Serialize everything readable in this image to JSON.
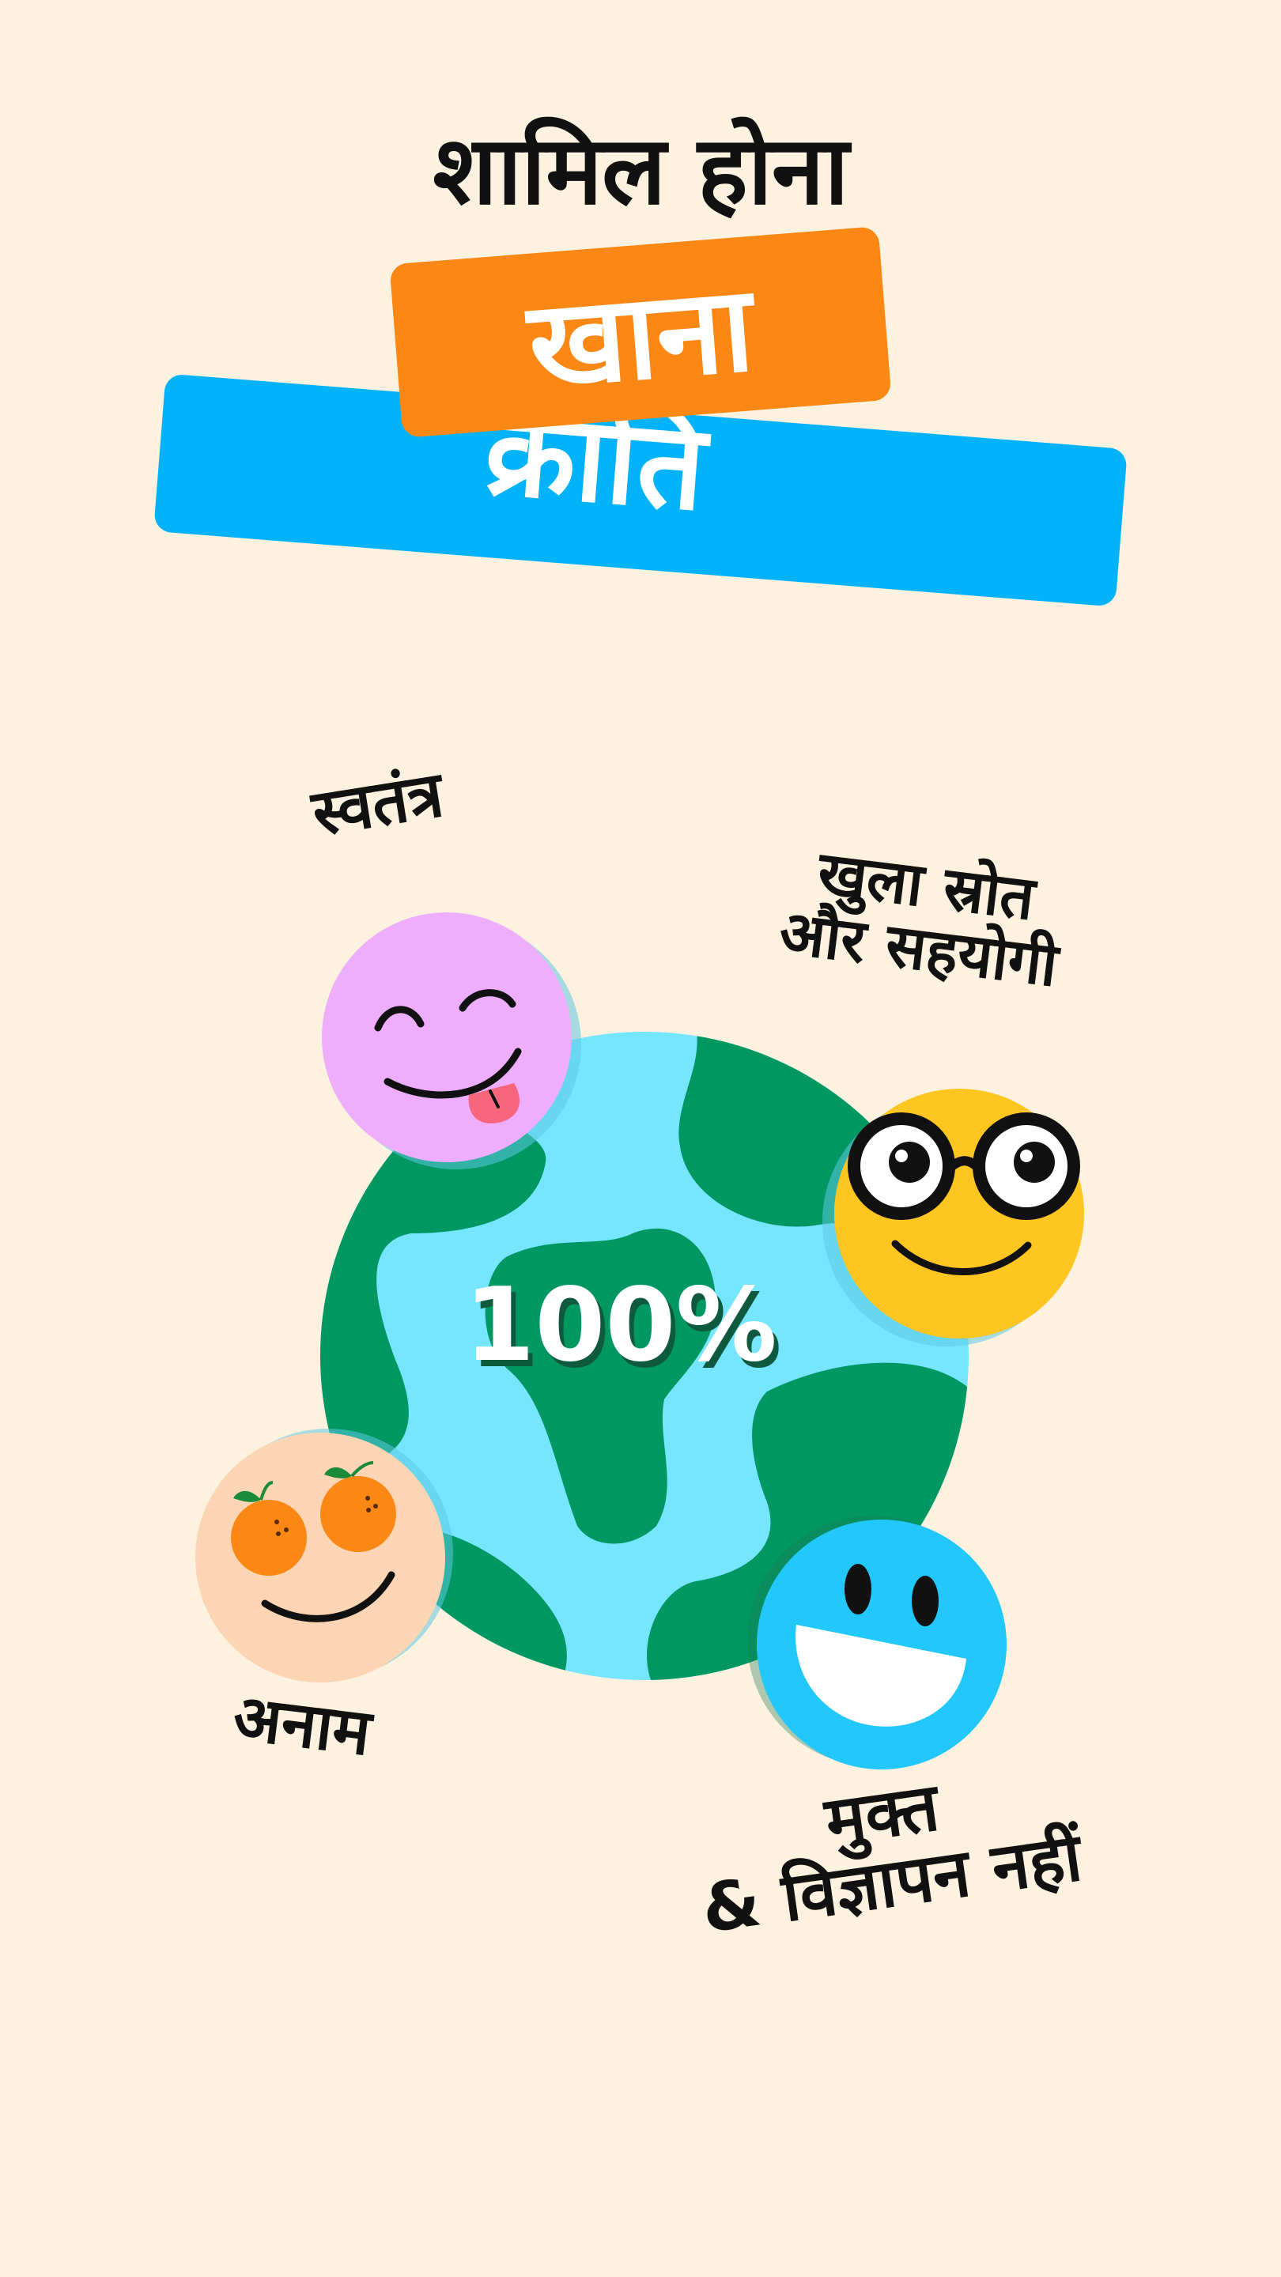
{
  "headline": "शामिल होना",
  "banners": {
    "orange": "खाना",
    "blue": "क्रांति"
  },
  "center_value": "100%",
  "features": {
    "free": "स्वतंत्र",
    "open_source_line1": "खुला स्रोत",
    "open_source_line2": "और सहयोगी",
    "anonymous": "अनाम",
    "ad_free_line1": "मुक्त",
    "ad_free_line2": "& विज्ञापन नहीं"
  },
  "colors": {
    "background": "#fdf1df",
    "orange": "#fb8714",
    "blue": "#02b3f9",
    "globe_ocean": "#76e6fe",
    "globe_land": "#019763",
    "pink_face": "#eeaefd",
    "yellow_face": "#ffc520",
    "peach_face": "#fcd6b4",
    "blue_face": "#22c8fc"
  },
  "icons": [
    "globe-icon",
    "tongue-out-face-icon",
    "glasses-face-icon",
    "orange-eyes-face-icon",
    "grinning-face-icon"
  ]
}
